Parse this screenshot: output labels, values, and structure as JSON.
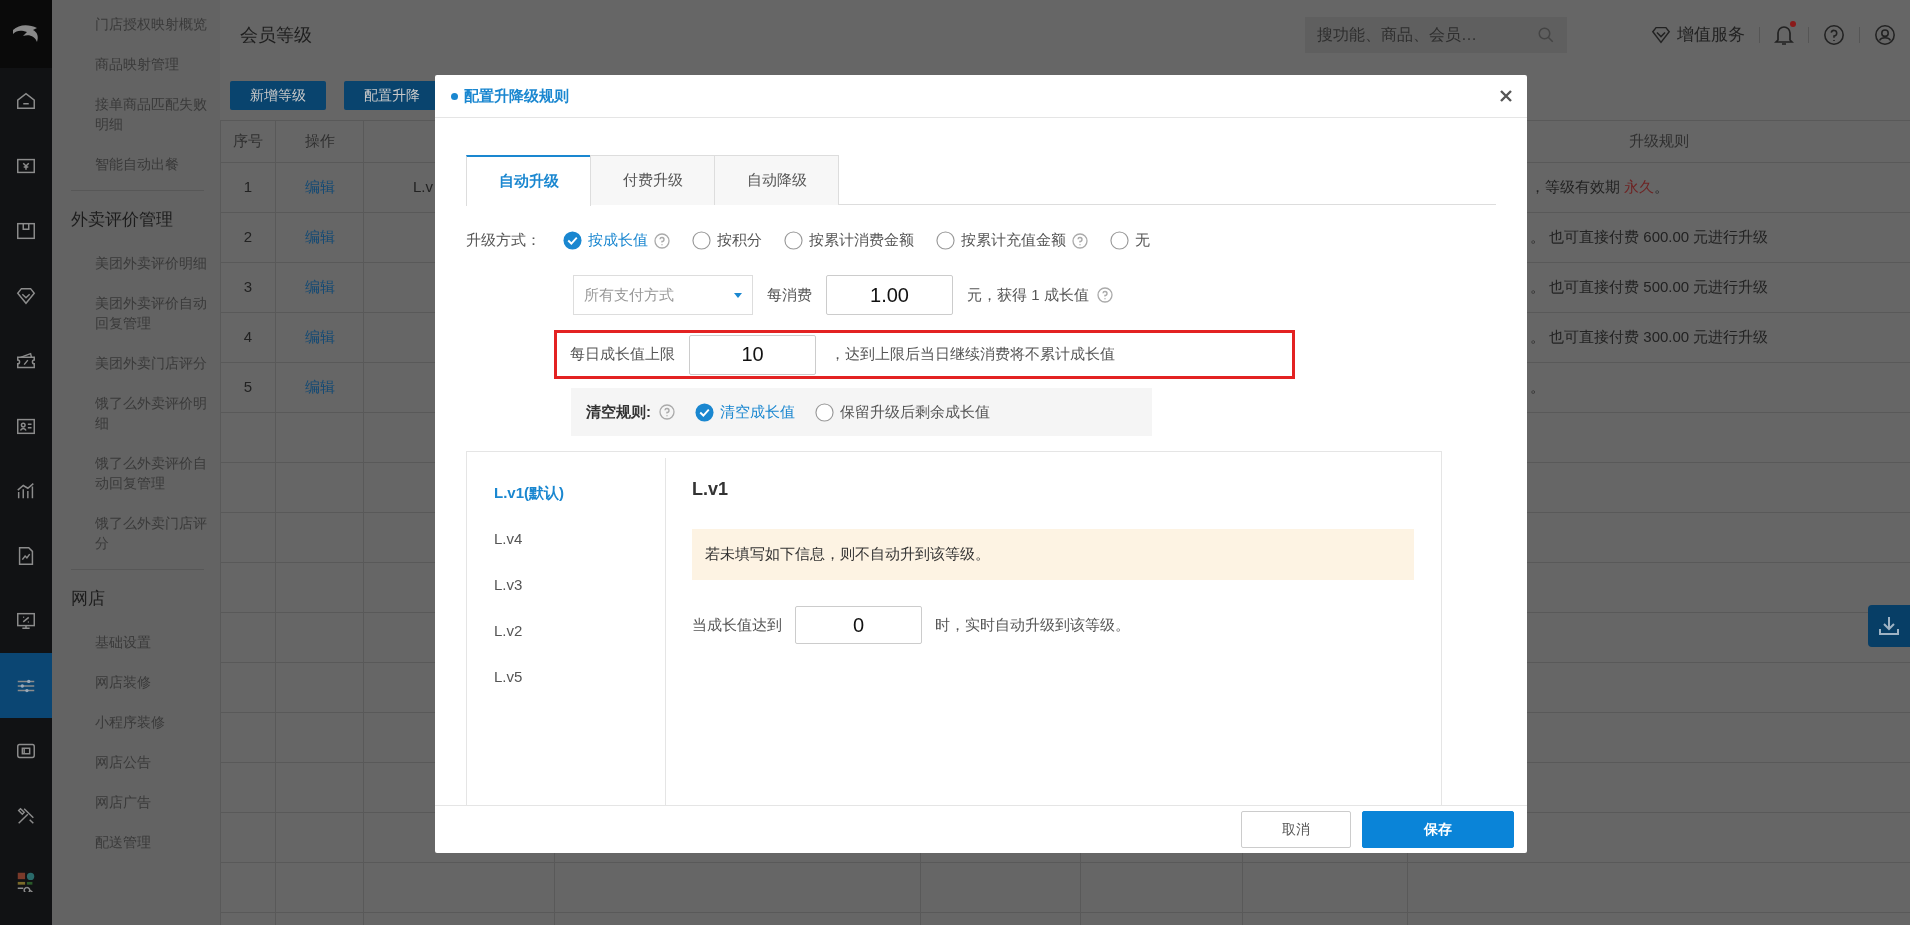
{
  "rail": [
    {
      "selected": false
    },
    {
      "selected": false
    },
    {
      "selected": false
    },
    {
      "selected": false
    },
    {
      "selected": false
    },
    {
      "selected": false
    },
    {
      "selected": false
    },
    {
      "selected": false
    },
    {
      "selected": false
    },
    {
      "selected": true
    },
    {
      "selected": false
    },
    {
      "selected": false
    },
    {
      "selected": false
    }
  ],
  "submenu": [
    {
      "kind": "item",
      "label": "门店授权映射概览"
    },
    {
      "kind": "item",
      "label": "商品映射管理"
    },
    {
      "kind": "item",
      "label": "接单商品匹配失败明细"
    },
    {
      "kind": "item",
      "label": "智能自动出餐"
    },
    {
      "kind": "divider"
    },
    {
      "kind": "group",
      "label": "外卖评价管理"
    },
    {
      "kind": "item",
      "label": "美团外卖评价明细"
    },
    {
      "kind": "item",
      "label": "美团外卖评价自动回复管理"
    },
    {
      "kind": "item",
      "label": "美团外卖门店评分"
    },
    {
      "kind": "item",
      "label": "饿了么外卖评价明细"
    },
    {
      "kind": "item",
      "label": "饿了么外卖评价自动回复管理"
    },
    {
      "kind": "item",
      "label": "饿了么外卖门店评分"
    },
    {
      "kind": "divider"
    },
    {
      "kind": "group",
      "label": "网店"
    },
    {
      "kind": "item",
      "label": "基础设置"
    },
    {
      "kind": "item",
      "label": "网店装修"
    },
    {
      "kind": "item",
      "label": "小程序装修"
    },
    {
      "kind": "item",
      "label": "网店公告"
    },
    {
      "kind": "item",
      "label": "网店广告"
    },
    {
      "kind": "item",
      "label": "配送管理"
    }
  ],
  "header": {
    "title": "会员等级",
    "search": {
      "placeholder": "搜功能、商品、会员…"
    },
    "value_service": "增值服务",
    "notification_dot": true
  },
  "toolbar": [
    "新增等级",
    "配置升降"
  ],
  "table": {
    "columns": {
      "number": "序号",
      "action": "操作",
      "rule": "升级规则"
    },
    "rows": [
      {
        "number": "1",
        "action": "编辑",
        "level": "L.v",
        "rule": [
          {
            "text": "，等级有效期 ",
            "highlight": false
          },
          {
            "text": "永久",
            "highlight": true
          },
          {
            "text": "。",
            "highlight": false
          }
        ]
      },
      {
        "number": "2",
        "action": "编辑",
        "rule": [
          {
            "text": "。 也可直接付费 600.00 元进行升级",
            "highlight": false
          }
        ]
      },
      {
        "number": "3",
        "action": "编辑",
        "rule": [
          {
            "text": "。 也可直接付费 500.00 元进行升级",
            "highlight": false
          }
        ]
      },
      {
        "number": "4",
        "action": "编辑",
        "rule": [
          {
            "text": "。 也可直接付费 300.00 元进行升级",
            "highlight": false
          }
        ]
      },
      {
        "number": "5",
        "action": "编辑",
        "rule": [
          {
            "text": "。",
            "highlight": false
          }
        ]
      }
    ]
  },
  "modal": {
    "title": "配置升降级规则",
    "tabs": [
      {
        "label": "自动升级",
        "selected": true
      },
      {
        "label": "付费升级",
        "selected": false
      },
      {
        "label": "自动降级",
        "selected": false
      }
    ],
    "upgrade_method": {
      "label": "升级方式：",
      "options": [
        {
          "label": "按成长值",
          "selected": true,
          "help": true
        },
        {
          "label": "按积分",
          "selected": false,
          "help": false
        },
        {
          "label": "按累计消费金额",
          "selected": false,
          "help": false
        },
        {
          "label": "按累计充值金额",
          "selected": false,
          "help": true
        },
        {
          "label": "无",
          "selected": false,
          "help": false
        }
      ]
    },
    "spend_rule": {
      "payment": "所有支付方式",
      "prefix": "每消费",
      "amount": "1.00",
      "suffix": "元，获得 1 成长值",
      "help": true
    },
    "daily_cap": {
      "label": "每日成长值上限",
      "value": "10",
      "note": "，达到上限后当日继续消费将不累计成长值",
      "highlighted": true
    },
    "clear_rule": {
      "label": "清空规则:",
      "help": true,
      "options": [
        {
          "label": "清空成长值",
          "selected": true
        },
        {
          "label": "保留升级后剩余成长值",
          "selected": false
        }
      ]
    },
    "levels": [
      {
        "label": "L.v1(默认)",
        "selected": true
      },
      {
        "label": "L.v4",
        "selected": false
      },
      {
        "label": "L.v3",
        "selected": false
      },
      {
        "label": "L.v2",
        "selected": false
      },
      {
        "label": "L.v5",
        "selected": false
      }
    ],
    "level_detail": {
      "title": "L.v1",
      "notice": "若未填写如下信息，则不自动升到该等级。",
      "prefix": "当成长值达到",
      "value": "0",
      "suffix": "时，实时自动升级到该等级。"
    },
    "buttons": [
      {
        "label": "取消",
        "kind": "secondary"
      },
      {
        "label": "保存",
        "kind": "primary"
      }
    ]
  }
}
